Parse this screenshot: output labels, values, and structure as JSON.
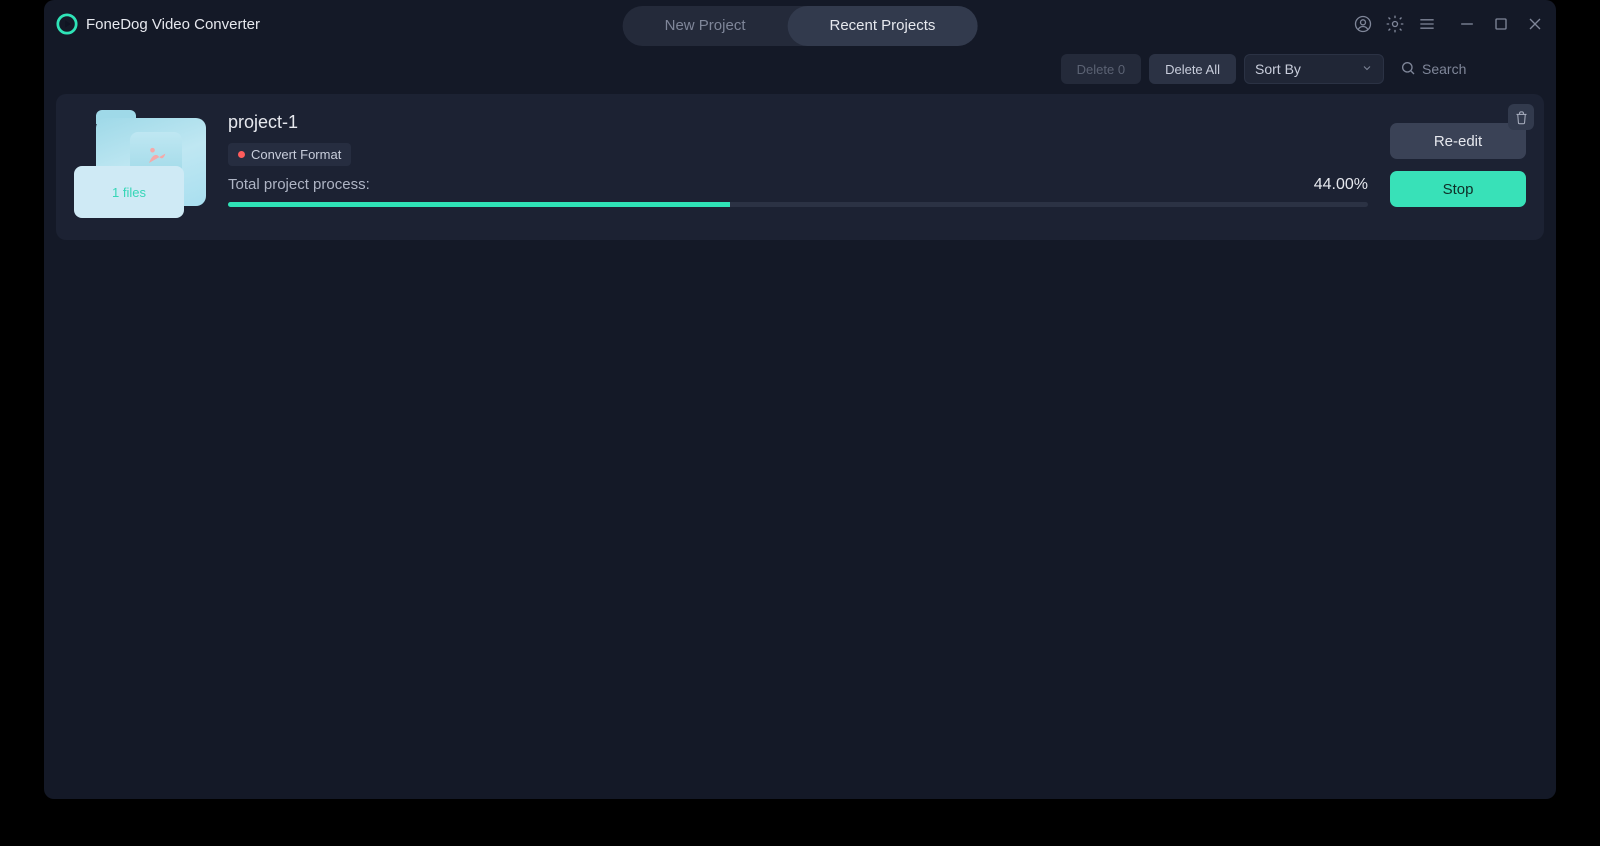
{
  "app": {
    "title": "FoneDog Video Converter"
  },
  "tabs": {
    "new_project": "New Project",
    "recent_projects": "Recent Projects"
  },
  "toolbar": {
    "delete_count_label": "Delete 0",
    "delete_all_label": "Delete All",
    "sort_by_label": "Sort By",
    "search_placeholder": "Search"
  },
  "project": {
    "name": "project-1",
    "tag": "Convert Format",
    "files_label": "1 files",
    "progress_label": "Total project process:",
    "percent_label": "44.00%",
    "percent_value": 44.0,
    "reedit_label": "Re-edit",
    "stop_label": "Stop"
  }
}
